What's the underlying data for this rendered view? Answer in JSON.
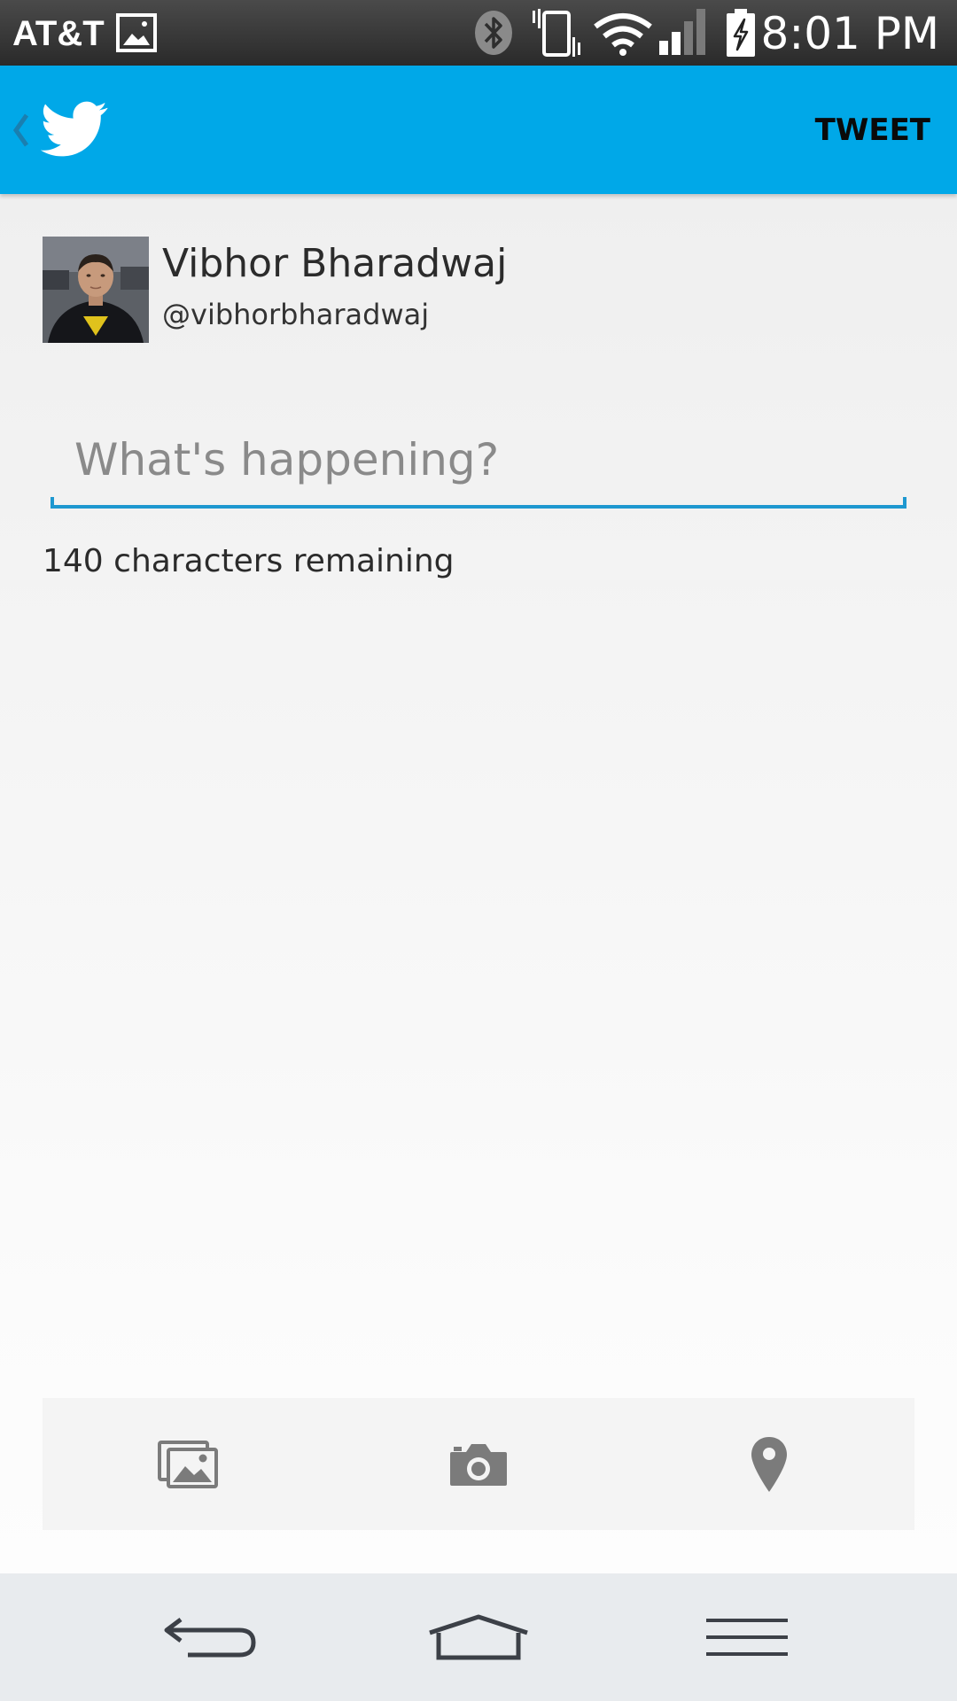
{
  "status_bar": {
    "carrier": "AT&T",
    "time": "8:01 PM",
    "icons": [
      "gallery-icon",
      "bluetooth-icon",
      "vibrate-icon",
      "wifi-icon",
      "signal-icon",
      "battery-charging-icon"
    ]
  },
  "app_bar": {
    "icon": "twitter-bird-icon",
    "tweet_label": "TWEET",
    "brand_color": "#00a8e8"
  },
  "account": {
    "name": "Vibhor Bharadwaj",
    "handle": "@vibhorbharadwaj"
  },
  "compose": {
    "placeholder": "What's happening?",
    "value": "",
    "counter_text": "140 characters remaining",
    "accent_color": "#1e98d0"
  },
  "attachments": {
    "icons": [
      "photo-gallery-icon",
      "camera-icon",
      "location-pin-icon"
    ]
  },
  "navigation": {
    "icons": [
      "back-icon",
      "home-icon",
      "menu-icon"
    ]
  }
}
